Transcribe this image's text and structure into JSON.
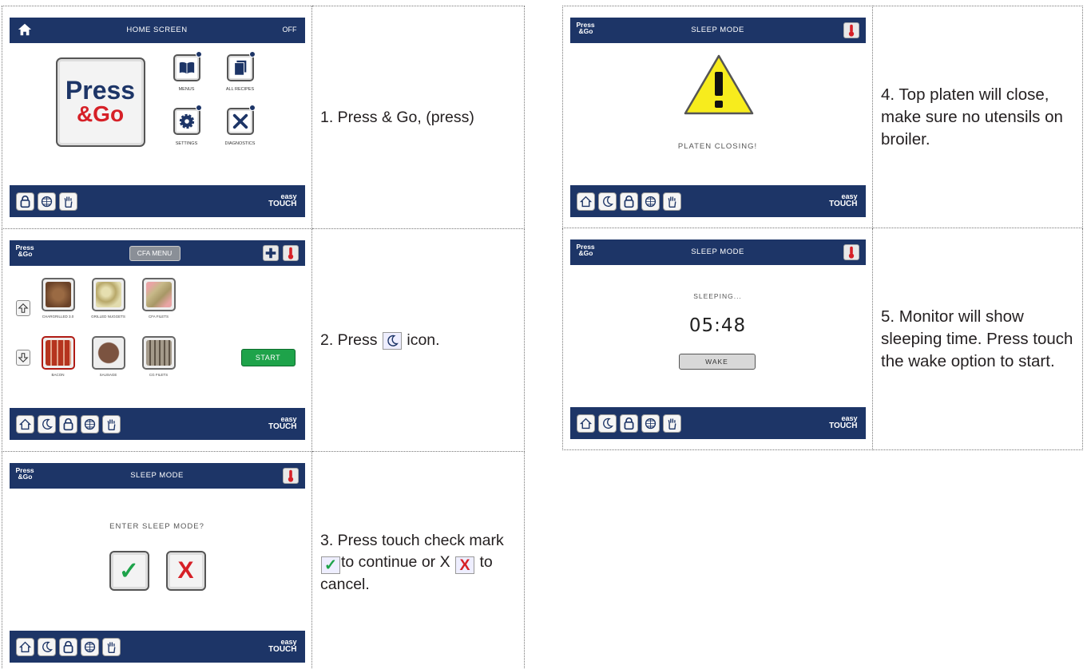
{
  "screens": {
    "home": {
      "title": "HOME SCREEN",
      "status": "OFF",
      "brand_line1": "Press",
      "brand_line2": "&Go",
      "tiles": [
        "MENUS",
        "ALL RECIPES",
        "SETTINGS",
        "DIAGNOSTICS"
      ]
    },
    "cfa": {
      "brand_line1": "Press",
      "brand_line2": "&Go",
      "menu_button": "CFA MENU",
      "start_button": "START",
      "items": [
        "CHARGRILLED 3.0",
        "GRILLED NUGGETS",
        "CFA FILETS",
        "BACON",
        "SAUSAGE",
        "CG FILETS"
      ],
      "colors": {
        "item1": "#7a5434",
        "item2": "#d8cf9a",
        "item3": "#c7b989",
        "item4": "#b5341e",
        "item5": "#7b5340",
        "item6": "#a49a8a"
      }
    },
    "sleep_confirm": {
      "brand_line1": "Press",
      "brand_line2": "&Go",
      "title": "SLEEP MODE",
      "prompt": "ENTER SLEEP MODE?",
      "confirm_symbol": "✓",
      "cancel_symbol": "X"
    },
    "platen": {
      "brand_line1": "Press",
      "brand_line2": "&Go",
      "title": "SLEEP MODE",
      "message": "PLATEN CLOSING!"
    },
    "sleeping": {
      "brand_line1": "Press",
      "brand_line2": "&Go",
      "title": "SLEEP MODE",
      "status": "SLEEPING...",
      "time": "05:48",
      "wake_button": "WAKE"
    }
  },
  "footer": {
    "brand_top": "easy",
    "brand_bottom": "TOUCH"
  },
  "steps": {
    "s1": "1. Press & Go, (press)",
    "s2a": "2. Press",
    "s2b": "icon.",
    "s3a": "3. Press touch check mark",
    "s3b": "to continue or X",
    "s3c": "to cancel.",
    "s3_check": "✓",
    "s3_x": "X",
    "s4": "4. Top platen will close, make sure no utensils on broiler.",
    "s5": "5. Monitor will show sleeping time. Press touch the wake option to start."
  },
  "colors": {
    "header": "#1d3567",
    "accent_red": "#d62027",
    "start_green": "#1ea34a",
    "warning_yellow": "#f7ec1d"
  }
}
